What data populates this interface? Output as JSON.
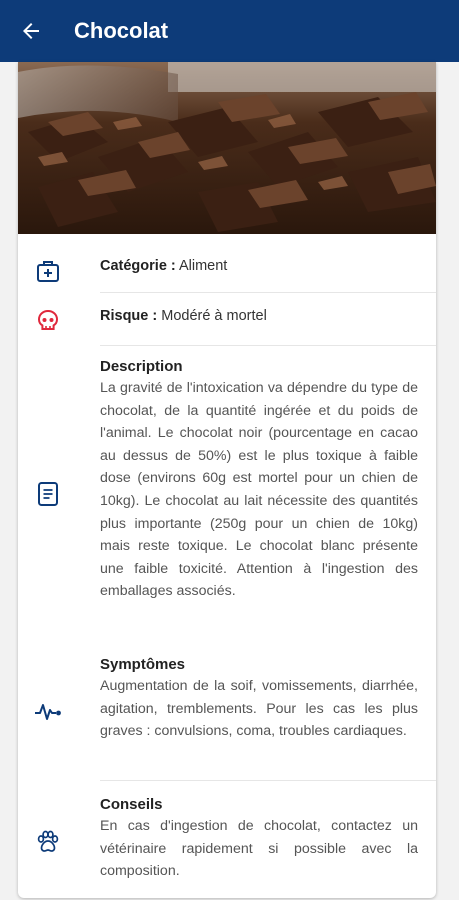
{
  "appbar": {
    "title": "Chocolat",
    "background": "#0d3b79"
  },
  "icons": {
    "back": "arrow-left-icon",
    "category": "first-aid-kit-icon",
    "risk": "skull-icon",
    "description": "document-icon",
    "symptoms": "heartbeat-pulse-icon",
    "advice": "paw-icon"
  },
  "image": {
    "alt": "Chocolat"
  },
  "category": {
    "label": "Catégorie :",
    "value": "Aliment"
  },
  "risk": {
    "label": "Risque :",
    "value": "Modéré à mortel",
    "color": "#e0283c"
  },
  "description": {
    "title": "Description",
    "text": "La gravité de l'intoxication va dépendre du type de chocolat, de la quantité ingérée et du poids de l'animal. Le chocolat noir (pourcentage en cacao au dessus de 50%) est le plus toxique à faible dose (environs 60g est mortel pour un chien de 10kg). Le chocolat au lait nécessite des quantités plus importante (250g pour un chien de 10kg) mais reste toxique. Le chocolat blanc présente une faible toxicité. Attention à l'ingestion des emballages associés."
  },
  "symptoms": {
    "title": "Symptômes",
    "text": "Augmentation de la soif, vomissements, diarrhée, agitation, tremblements. Pour les cas les plus graves : convulsions, coma, troubles cardiaques."
  },
  "advice": {
    "title": "Conseils",
    "text": "En cas d'ingestion de chocolat, contactez un vétérinaire rapidement si possible avec la composition."
  },
  "colors": {
    "accent": "#0d3b79",
    "risk": "#e0283c"
  }
}
